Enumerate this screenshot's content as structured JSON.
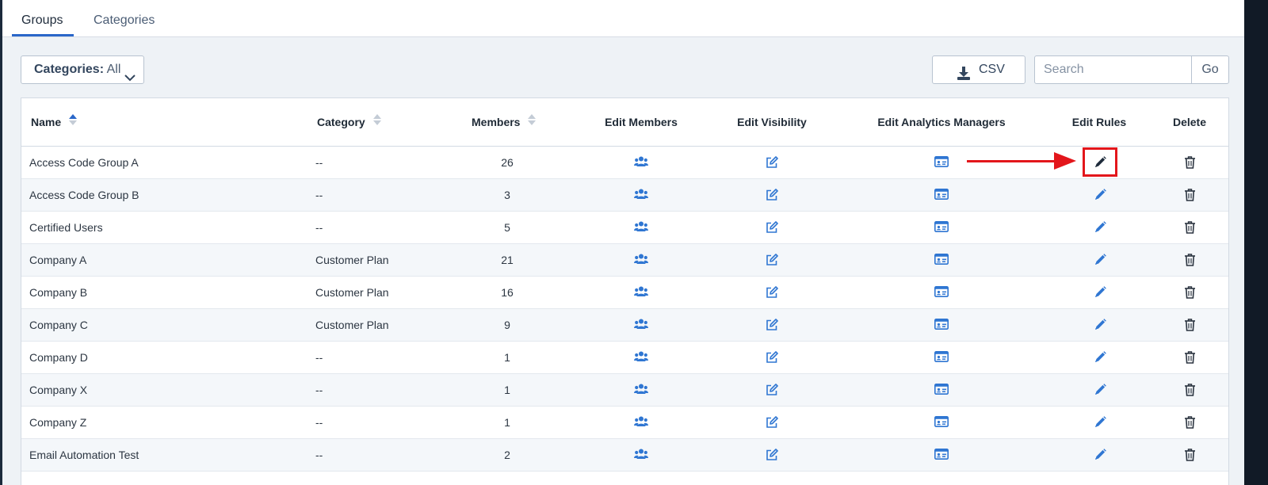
{
  "tabs": [
    {
      "label": "Groups",
      "active": true
    },
    {
      "label": "Categories",
      "active": false
    }
  ],
  "toolbar": {
    "categories_label": "Categories:",
    "categories_value": "All",
    "csv_label": "CSV",
    "search_placeholder": "Search",
    "go_label": "Go"
  },
  "table": {
    "columns": {
      "name": "Name",
      "category": "Category",
      "members": "Members",
      "edit_members": "Edit Members",
      "edit_visibility": "Edit Visibility",
      "edit_analytics_managers": "Edit Analytics Managers",
      "edit_rules": "Edit Rules",
      "delete": "Delete"
    },
    "rows": [
      {
        "name": "Access Code Group A",
        "category": "--",
        "members": "26"
      },
      {
        "name": "Access Code Group B",
        "category": "--",
        "members": "3"
      },
      {
        "name": "Certified Users",
        "category": "--",
        "members": "5"
      },
      {
        "name": "Company A",
        "category": "Customer Plan",
        "members": "21"
      },
      {
        "name": "Company B",
        "category": "Customer Plan",
        "members": "16"
      },
      {
        "name": "Company C",
        "category": "Customer Plan",
        "members": "9"
      },
      {
        "name": "Company D",
        "category": "--",
        "members": "1"
      },
      {
        "name": "Company X",
        "category": "--",
        "members": "1"
      },
      {
        "name": "Company Z",
        "category": "--",
        "members": "1"
      },
      {
        "name": "Email Automation Test",
        "category": "--",
        "members": "2"
      }
    ]
  },
  "icons": {
    "edit_members": "users-icon",
    "edit_visibility": "edit-square-icon",
    "edit_analytics_managers": "id-card-icon",
    "edit_rules": "pencil-icon",
    "delete": "trash-icon",
    "csv": "download-icon"
  },
  "colors": {
    "accent": "#2a67c9",
    "icon_blue": "#2f76d2",
    "annotation_red": "#e3161b",
    "alt_row": "#f4f7fa"
  },
  "annotation": {
    "highlighted_row": 0,
    "highlighted_column": "edit_rules"
  }
}
